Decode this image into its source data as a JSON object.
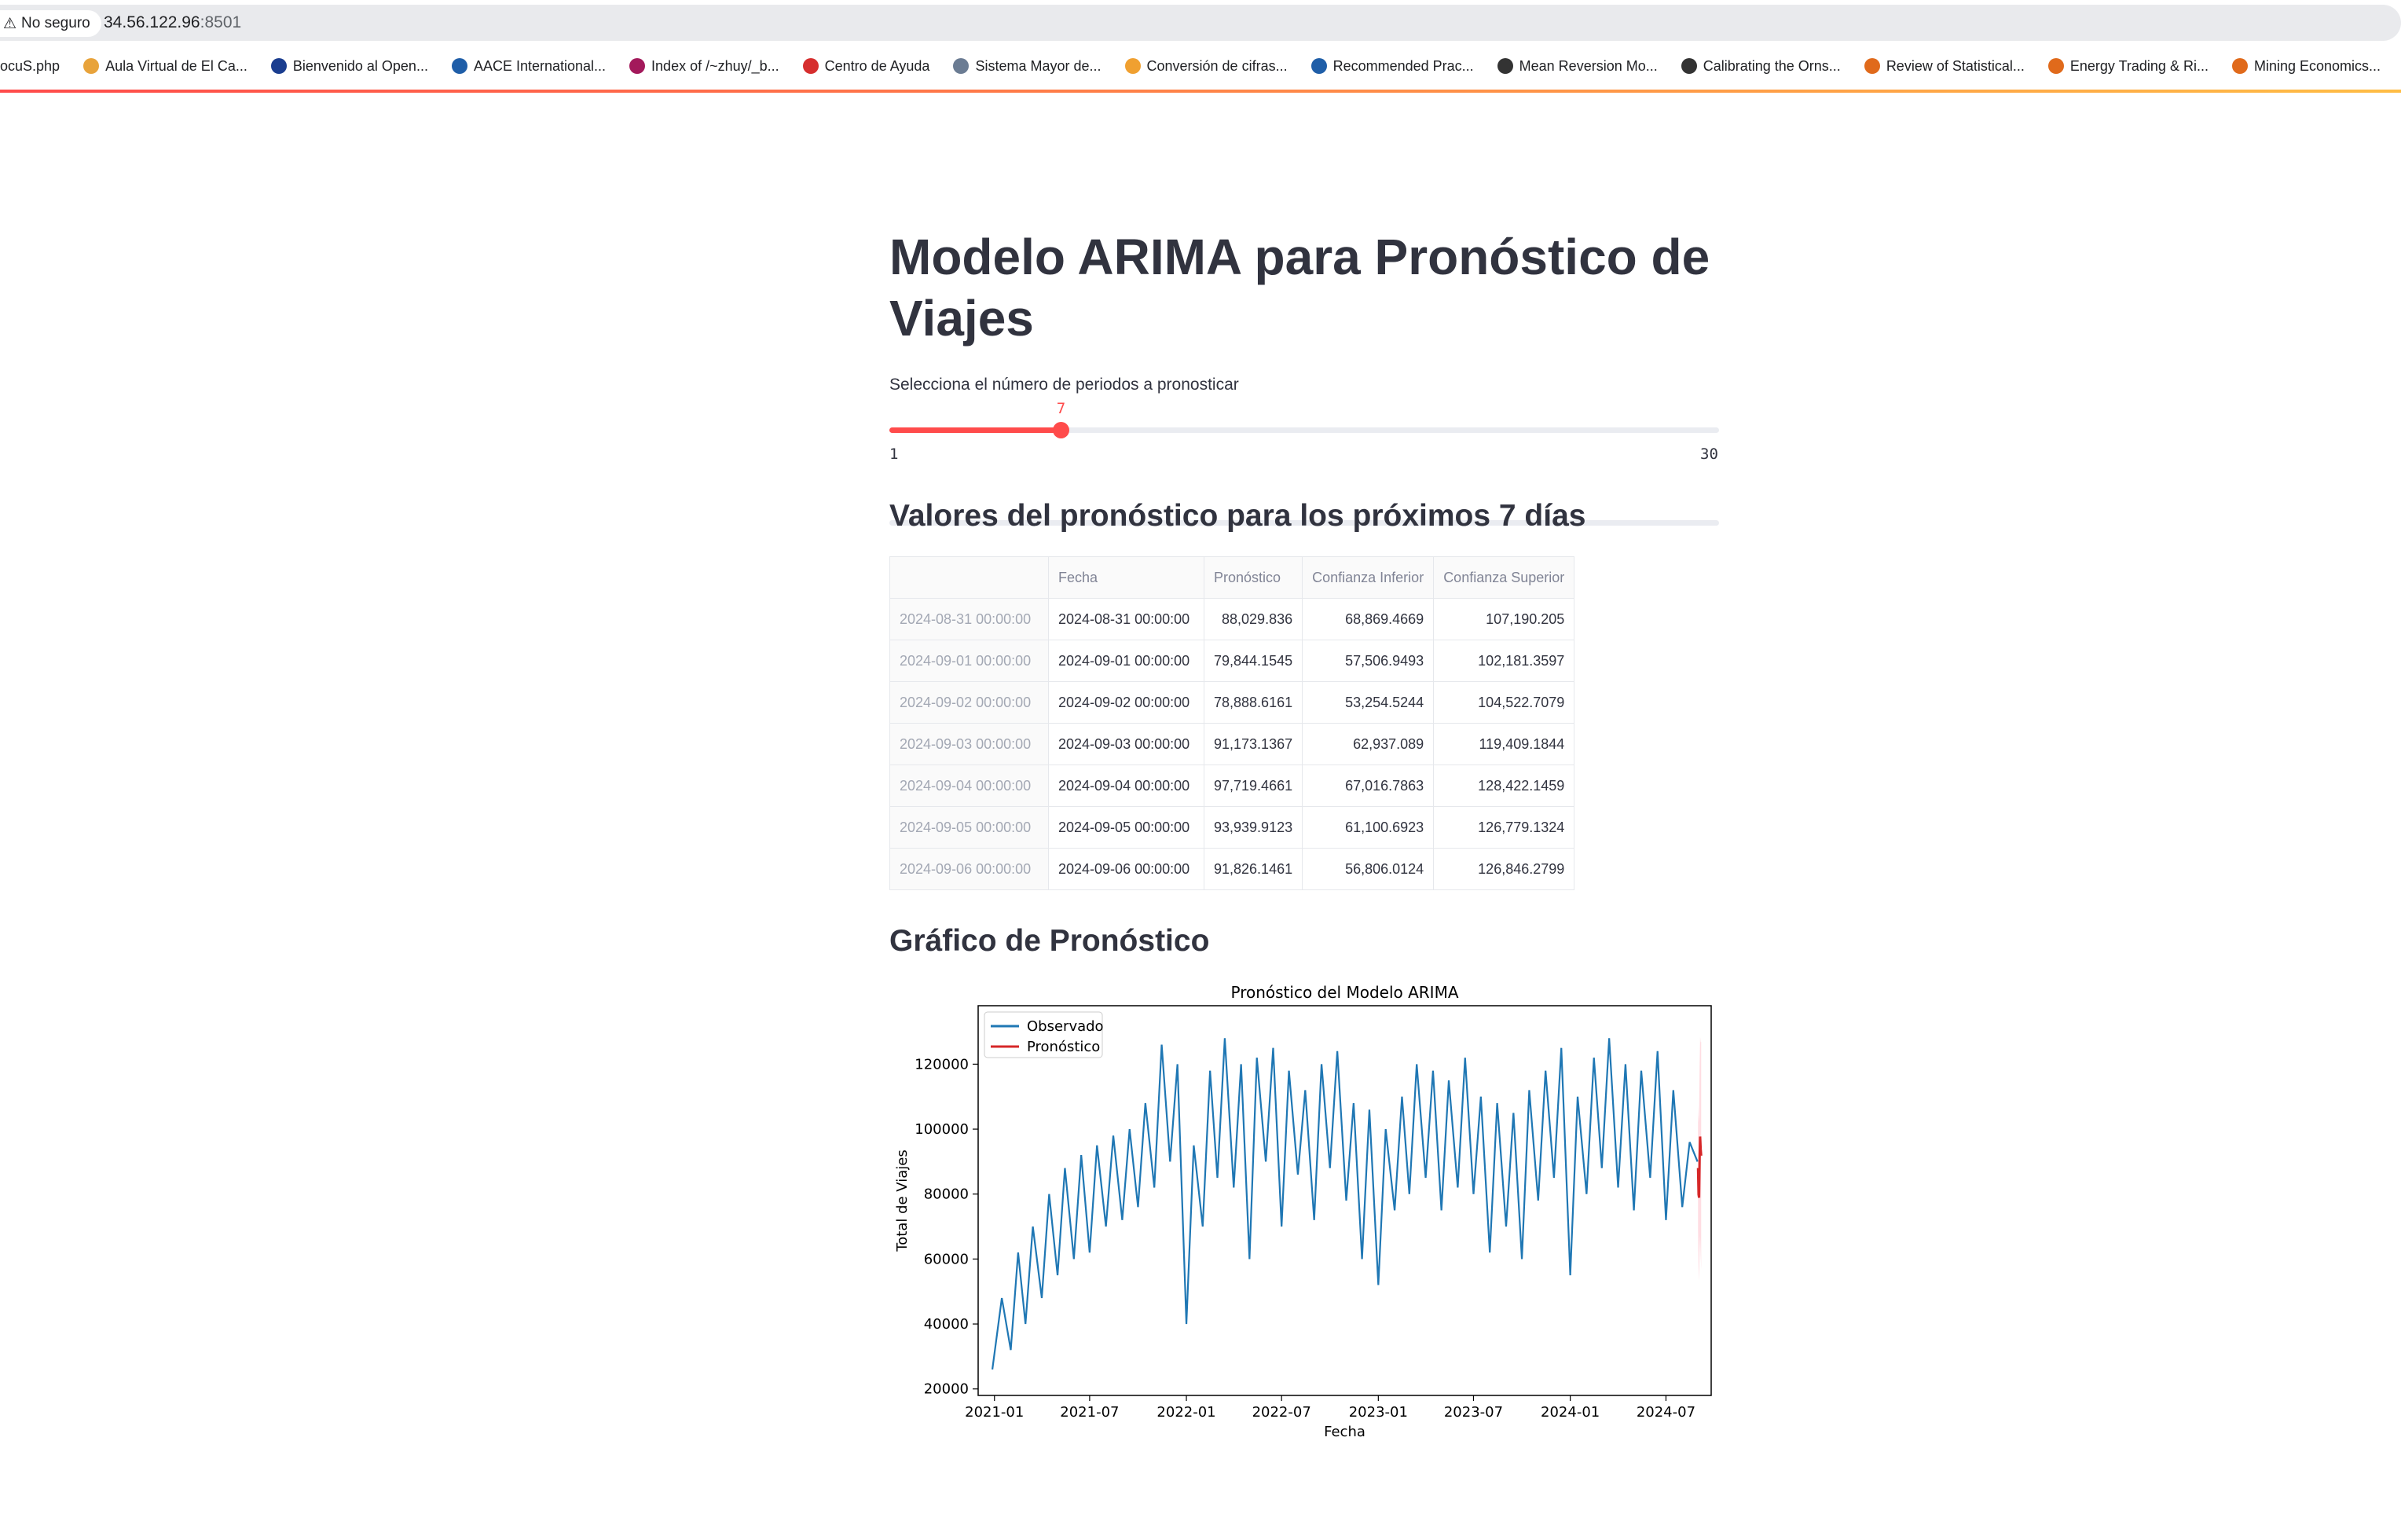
{
  "browser": {
    "security_label": "No seguro",
    "url_host": "34.56.122.96",
    "url_port": ":8501",
    "bookmarks": [
      {
        "label": "ocuS.php",
        "color": "#ffffff"
      },
      {
        "label": "Aula Virtual de El Ca...",
        "color": "#e8a33b"
      },
      {
        "label": "Bienvenido al Open...",
        "color": "#1a3d8f"
      },
      {
        "label": "AACE International...",
        "color": "#1f5ea8"
      },
      {
        "label": "Index of /~zhuy/_b...",
        "color": "#a3195b"
      },
      {
        "label": "Centro de Ayuda",
        "color": "#d62e2e"
      },
      {
        "label": "Sistema Mayor de...",
        "color": "#6b7c93"
      },
      {
        "label": "Conversión de cifras...",
        "color": "#f0a030"
      },
      {
        "label": "Recommended Prac...",
        "color": "#1f5ea8"
      },
      {
        "label": "Mean Reversion Mo...",
        "color": "#333333"
      },
      {
        "label": "Calibrating the Orns...",
        "color": "#333333"
      },
      {
        "label": "Review of Statistical...",
        "color": "#e06a1b"
      },
      {
        "label": "Energy Trading & Ri...",
        "color": "#e06a1b"
      },
      {
        "label": "Mining Economics...",
        "color": "#e06a1b"
      }
    ]
  },
  "app": {
    "title": "Modelo ARIMA para Pronóstico de Viajes",
    "slider_label": "Selecciona el número de periodos a pronosticar",
    "slider": {
      "min": 1,
      "max": 30,
      "value": 7,
      "min_label": "1",
      "max_label": "30",
      "value_label": "7"
    },
    "table_heading": "Valores del pronóstico para los próximos 7 días",
    "chart_heading": "Gráfico de Pronóstico",
    "accent": "#ff4b4b"
  },
  "table": {
    "columns": [
      "",
      "Fecha",
      "Pronóstico",
      "Confianza Inferior",
      "Confianza Superior"
    ],
    "rows": [
      [
        "2024-08-31 00:00:00",
        "2024-08-31 00:00:00",
        "88,029.836",
        "68,869.4669",
        "107,190.205"
      ],
      [
        "2024-09-01 00:00:00",
        "2024-09-01 00:00:00",
        "79,844.1545",
        "57,506.9493",
        "102,181.3597"
      ],
      [
        "2024-09-02 00:00:00",
        "2024-09-02 00:00:00",
        "78,888.6161",
        "53,254.5244",
        "104,522.7079"
      ],
      [
        "2024-09-03 00:00:00",
        "2024-09-03 00:00:00",
        "91,173.1367",
        "62,937.089",
        "119,409.1844"
      ],
      [
        "2024-09-04 00:00:00",
        "2024-09-04 00:00:00",
        "97,719.4661",
        "67,016.7863",
        "128,422.1459"
      ],
      [
        "2024-09-05 00:00:00",
        "2024-09-05 00:00:00",
        "93,939.9123",
        "61,100.6923",
        "126,779.1324"
      ],
      [
        "2024-09-06 00:00:00",
        "2024-09-06 00:00:00",
        "91,826.1461",
        "56,806.0124",
        "126,846.2799"
      ]
    ]
  },
  "chart_data": {
    "type": "line",
    "title": "Pronóstico del Modelo ARIMA",
    "xlabel": "Fecha",
    "ylabel": "Total de Viajes",
    "ylim": [
      18000,
      138000
    ],
    "xlim": [
      "2020-12-01",
      "2024-09-25"
    ],
    "yticks": [
      20000,
      40000,
      60000,
      80000,
      100000,
      120000
    ],
    "xticks": [
      "2021-01",
      "2021-07",
      "2022-01",
      "2022-07",
      "2023-01",
      "2023-07",
      "2024-01",
      "2024-07"
    ],
    "legend_position": "top-left",
    "series": [
      {
        "name": "Observado",
        "color": "#1f77b4",
        "x": [
          "2020-12-28",
          "2021-01-15",
          "2021-02-01",
          "2021-02-15",
          "2021-03-01",
          "2021-03-15",
          "2021-04-01",
          "2021-04-15",
          "2021-05-01",
          "2021-05-15",
          "2021-06-01",
          "2021-06-15",
          "2021-07-01",
          "2021-07-15",
          "2021-08-01",
          "2021-08-15",
          "2021-09-01",
          "2021-09-15",
          "2021-10-01",
          "2021-10-15",
          "2021-11-01",
          "2021-11-15",
          "2021-12-01",
          "2021-12-15",
          "2022-01-01",
          "2022-01-15",
          "2022-02-01",
          "2022-02-15",
          "2022-03-01",
          "2022-03-15",
          "2022-04-01",
          "2022-04-15",
          "2022-05-01",
          "2022-05-15",
          "2022-06-01",
          "2022-06-15",
          "2022-07-01",
          "2022-07-15",
          "2022-08-01",
          "2022-08-15",
          "2022-09-01",
          "2022-09-15",
          "2022-10-01",
          "2022-10-15",
          "2022-11-01",
          "2022-11-15",
          "2022-12-01",
          "2022-12-15",
          "2023-01-01",
          "2023-01-15",
          "2023-02-01",
          "2023-02-15",
          "2023-03-01",
          "2023-03-15",
          "2023-04-01",
          "2023-04-15",
          "2023-05-01",
          "2023-05-15",
          "2023-06-01",
          "2023-06-15",
          "2023-07-01",
          "2023-07-15",
          "2023-08-01",
          "2023-08-15",
          "2023-09-01",
          "2023-09-15",
          "2023-10-01",
          "2023-10-15",
          "2023-11-01",
          "2023-11-15",
          "2023-12-01",
          "2023-12-15",
          "2024-01-01",
          "2024-01-15",
          "2024-02-01",
          "2024-02-15",
          "2024-03-01",
          "2024-03-15",
          "2024-04-01",
          "2024-04-15",
          "2024-05-01",
          "2024-05-15",
          "2024-06-01",
          "2024-06-15",
          "2024-07-01",
          "2024-07-15",
          "2024-08-01",
          "2024-08-15",
          "2024-08-30"
        ],
        "values": [
          26000,
          48000,
          32000,
          62000,
          40000,
          70000,
          48000,
          80000,
          55000,
          88000,
          60000,
          92000,
          62000,
          95000,
          70000,
          98000,
          72000,
          100000,
          76000,
          108000,
          82000,
          126000,
          90000,
          120000,
          40000,
          95000,
          70000,
          118000,
          85000,
          128000,
          82000,
          120000,
          60000,
          122000,
          90000,
          125000,
          70000,
          118000,
          86000,
          112000,
          72000,
          120000,
          88000,
          124000,
          78000,
          108000,
          60000,
          106000,
          52000,
          100000,
          75000,
          110000,
          80000,
          120000,
          85000,
          118000,
          75000,
          115000,
          82000,
          122000,
          80000,
          110000,
          62000,
          108000,
          70000,
          105000,
          60000,
          112000,
          78000,
          118000,
          85000,
          125000,
          55000,
          110000,
          80000,
          122000,
          88000,
          128000,
          82000,
          120000,
          75000,
          118000,
          85000,
          124000,
          72000,
          112000,
          76000,
          96000,
          90000
        ]
      },
      {
        "name": "Pronóstico",
        "color": "#d62728",
        "x": [
          "2024-08-31",
          "2024-09-01",
          "2024-09-02",
          "2024-09-03",
          "2024-09-04",
          "2024-09-05",
          "2024-09-06"
        ],
        "values": [
          88029.836,
          79844.1545,
          78888.6161,
          91173.1367,
          97719.4661,
          93939.9123,
          91826.1461
        ],
        "lower": [
          68869.4669,
          57506.9493,
          53254.5244,
          62937.089,
          67016.7863,
          61100.6923,
          56806.0124
        ],
        "upper": [
          107190.205,
          102181.3597,
          104522.7079,
          119409.1844,
          128422.1459,
          126779.1324,
          126846.2799
        ]
      }
    ]
  }
}
